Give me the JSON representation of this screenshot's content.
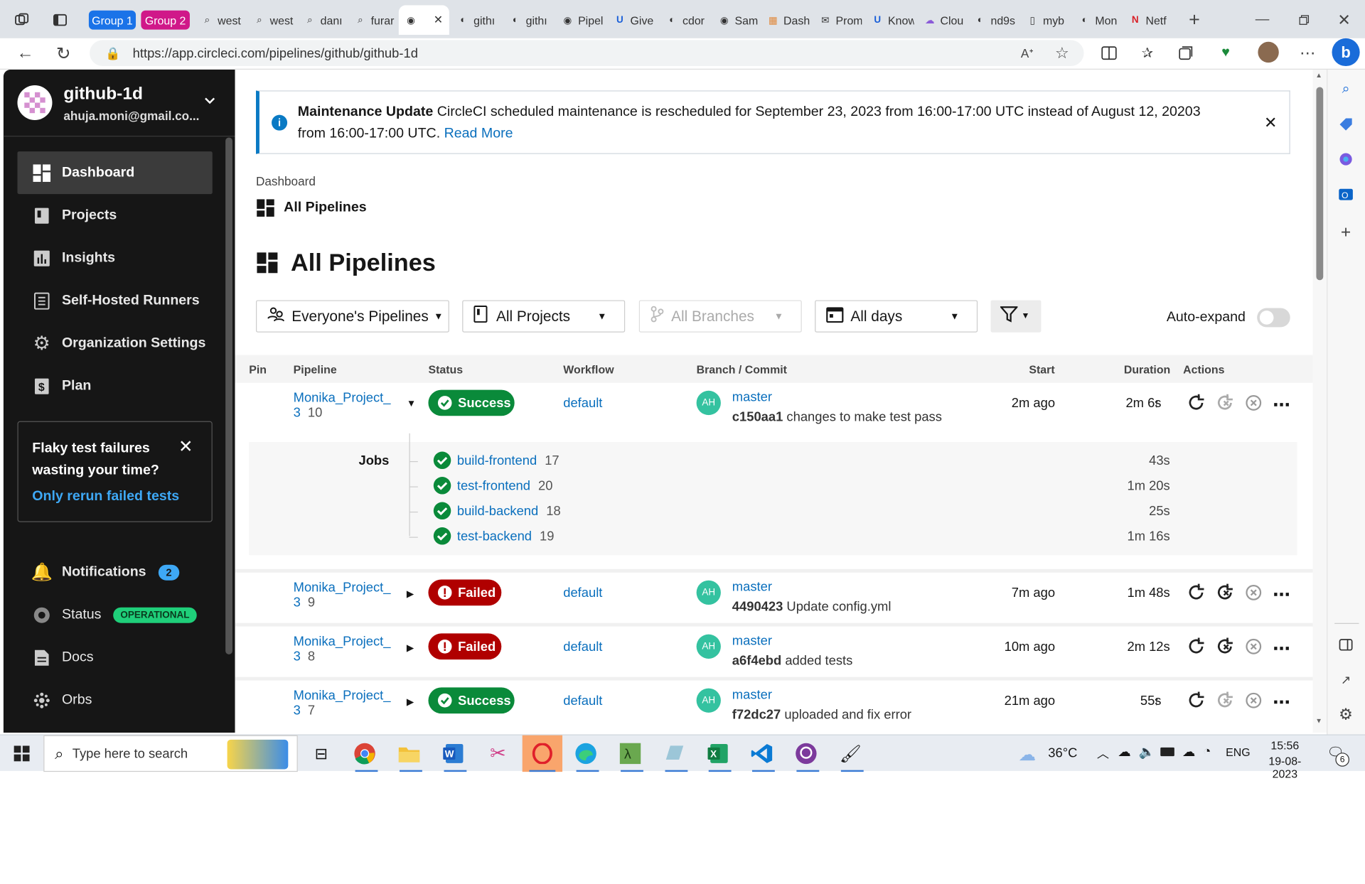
{
  "browser": {
    "groups": [
      {
        "label": "Group 1",
        "color": "#1a73e8"
      },
      {
        "label": "Group 2",
        "color": "#d01889"
      }
    ],
    "tabs": [
      {
        "label": "west",
        "icon": "search-icon"
      },
      {
        "label": "west",
        "icon": "search-icon"
      },
      {
        "label": "danı",
        "icon": "search-icon"
      },
      {
        "label": "furar",
        "icon": "search-icon"
      },
      {
        "label": "",
        "icon": "circleci-icon",
        "active": true
      },
      {
        "label": "githı",
        "icon": "github-icon"
      },
      {
        "label": "githı",
        "icon": "github-icon"
      },
      {
        "label": "Pipel",
        "icon": "circleci-icon"
      },
      {
        "label": "Give",
        "icon": "udacity-icon"
      },
      {
        "label": "cdor",
        "icon": "github-icon"
      },
      {
        "label": "Sam",
        "icon": "circleci-icon"
      },
      {
        "label": "Dash",
        "icon": "dashboard-icon"
      },
      {
        "label": "Prom",
        "icon": "mail-icon"
      },
      {
        "label": "Know",
        "icon": "udacity-icon"
      },
      {
        "label": "Clou",
        "icon": "cloud-icon"
      },
      {
        "label": "nd9s",
        "icon": "github-icon"
      },
      {
        "label": "myb",
        "icon": "file-icon"
      },
      {
        "label": "Mon",
        "icon": "github-icon"
      },
      {
        "label": "Netf",
        "icon": "netflix-icon"
      }
    ],
    "url": "https://app.circleci.com/pipelines/github/github-1d"
  },
  "sidebar": {
    "org_name": "github-1d",
    "email": "ahuja.moni@gmail.co...",
    "nav": [
      {
        "label": "Dashboard",
        "icon": "dashboard-icon",
        "active": true
      },
      {
        "label": "Projects",
        "icon": "projects-icon"
      },
      {
        "label": "Insights",
        "icon": "insights-icon"
      },
      {
        "label": "Self-Hosted Runners",
        "icon": "runners-icon"
      },
      {
        "label": "Organization Settings",
        "icon": "gear-icon"
      },
      {
        "label": "Plan",
        "icon": "dollar-icon"
      }
    ],
    "promo": {
      "title_line1": "Flaky test failures",
      "title_line2": "wasting your time?",
      "link": "Only rerun failed tests"
    },
    "bottom": [
      {
        "label": "Notifications",
        "icon": "bell-icon",
        "badge": "2"
      },
      {
        "label": "Status",
        "icon": "status-icon",
        "badge": "OPERATIONAL"
      },
      {
        "label": "Docs",
        "icon": "docs-icon"
      },
      {
        "label": "Orbs",
        "icon": "orbs-icon"
      }
    ]
  },
  "banner": {
    "title": "Maintenance Update",
    "text_line1": "CircleCI scheduled maintenance is rescheduled for September 23, 2023 from 16:00-17:00 UTC instead of August 12, 20203",
    "text_line2": "from 16:00-17:00 UTC.",
    "link": "Read More"
  },
  "breadcrumb": {
    "parent": "Dashboard",
    "current": "All Pipelines"
  },
  "page_title": "All Pipelines",
  "filters": {
    "pipelines": "Everyone's Pipelines",
    "projects": "All Projects",
    "branches": "All Branches",
    "days": "All days",
    "auto_expand": "Auto-expand",
    "auto_expand_on": false
  },
  "table": {
    "headers": {
      "pin": "Pin",
      "pipeline": "Pipeline",
      "status": "Status",
      "workflow": "Workflow",
      "branch": "Branch / Commit",
      "start": "Start",
      "duration": "Duration",
      "actions": "Actions"
    },
    "rows": [
      {
        "name_l1": "Monika_Project_",
        "name_l2": "3",
        "num": "10",
        "status": "Success",
        "workflow": "default",
        "avatar": "AH",
        "branch": "master",
        "sha": "c150aa1",
        "msg": "changes to make test pass",
        "start": "2m ago",
        "duration": "2m 6s",
        "expanded": true
      },
      {
        "name_l1": "Monika_Project_",
        "name_l2": "3",
        "num": "9",
        "status": "Failed",
        "workflow": "default",
        "avatar": "AH",
        "branch": "master",
        "sha": "4490423",
        "msg": "Update config.yml",
        "start": "7m ago",
        "duration": "1m 48s"
      },
      {
        "name_l1": "Monika_Project_",
        "name_l2": "3",
        "num": "8",
        "status": "Failed",
        "workflow": "default",
        "avatar": "AH",
        "branch": "master",
        "sha": "a6f4ebd",
        "msg": "added tests",
        "start": "10m ago",
        "duration": "2m 12s"
      },
      {
        "name_l1": "Monika_Project_",
        "name_l2": "3",
        "num": "7",
        "status": "Success",
        "workflow": "default",
        "avatar": "AH",
        "branch": "master",
        "sha": "f72dc27",
        "msg": "uploaded and fix error",
        "start": "21m ago",
        "duration": "55s"
      }
    ],
    "jobs_label": "Jobs",
    "jobs": [
      {
        "name": "build-frontend",
        "num": "17",
        "duration": "43s"
      },
      {
        "name": "test-frontend",
        "num": "20",
        "duration": "1m 20s"
      },
      {
        "name": "build-backend",
        "num": "18",
        "duration": "25s"
      },
      {
        "name": "test-backend",
        "num": "19",
        "duration": "1m 16s"
      }
    ]
  },
  "taskbar": {
    "search_placeholder": "Type here to search",
    "weather": "36°C",
    "lang": "ENG",
    "time": "15:56",
    "date": "19-08-2023",
    "notif_count": "6"
  },
  "colors": {
    "success": "#0a8a3a",
    "failed": "#b00000",
    "link": "#0a6fbd",
    "sidebar": "#161616"
  }
}
